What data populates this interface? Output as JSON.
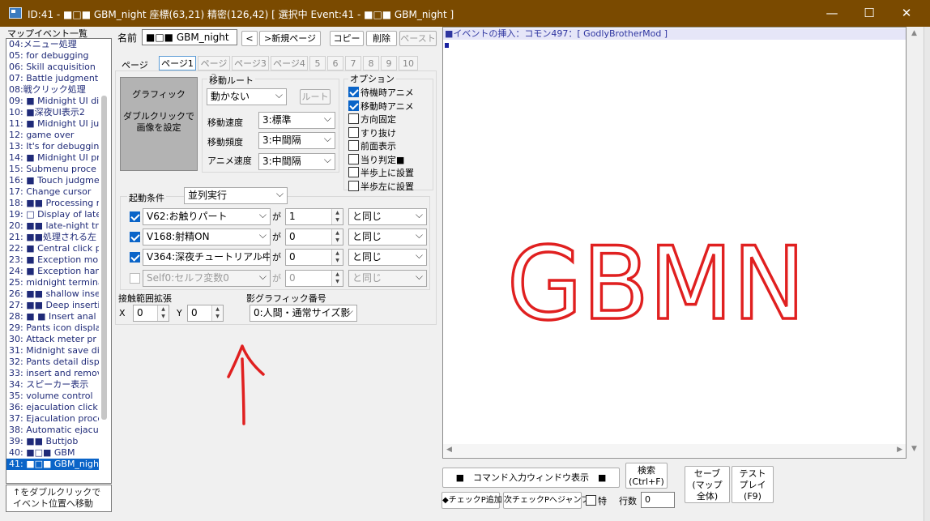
{
  "titlebar": {
    "title": "ID:41 - ■□■ GBM_night 座標(63,21) 精密(126,42) [ 選択中 Event:41 - ■□■ GBM_night ]",
    "minimize": "—",
    "maximize": "☐",
    "close": "✕"
  },
  "event_list": {
    "header": "マップイベント一覧",
    "items": [
      "04:メニュー処理",
      "05: for debugging",
      "06: Skill acquisition r",
      "07: Battle judgment",
      "08:戦クリック処理",
      "09: ■ Midnight UI dis",
      "10: ■深夜UI表示2",
      "11: ■ Midnight UI ju",
      "12: game over",
      "13: It's for debuggin",
      "14: ■ Midnight UI pr",
      "15: Submenu proce",
      "16: ■ Touch judgme",
      "17: Change cursor",
      "18: ■■ Processing ri",
      "19: □ Display of late-",
      "20: ■■ late-night tre",
      "21: ■■処理される左",
      "22: ■ Central click pr",
      "23: ■ Exception mor",
      "24: ■ Exception han",
      "25: midnight termina",
      "26: ■■ shallow inser",
      "27: ■■ Deep insertic",
      "28: ■ ■ Insert anal",
      "29: Pants icon displa",
      "30: Attack meter pr",
      "31: Midnight save di",
      "32: Pants detail disp",
      "33: insert and remov",
      "34: スピーカー表示",
      "35: volume control",
      "36: ejaculation click",
      "37: Ejaculation proce",
      "38: Automatic ejacu",
      "39: ■■ Buttjob",
      "40: ■□■ GBM",
      "41: ■□■ GBM_night"
    ],
    "selected_index": 37,
    "hint": "↑をダブルクリックで\nイベント位置へ移動"
  },
  "name_row": {
    "label": "名前",
    "value": "■□■ GBM_night",
    "prev_button": "<",
    "new_page_button": ">新規ページ",
    "copy_button": "コピー",
    "delete_button": "削除",
    "paste_button": "ペースト"
  },
  "tabs": {
    "label": "ページ",
    "items": [
      "ページ1",
      "ページ2",
      "ページ3",
      "ページ4",
      "5",
      "6",
      "7",
      "8",
      "9",
      "10"
    ],
    "active_index": 0
  },
  "graphic": {
    "title": "グラフィック",
    "hint_line1": "ダブルクリックで",
    "hint_line2": "画像を設定"
  },
  "move_route": {
    "title": "移動ルート",
    "type": "動かない",
    "route_button": "ルート",
    "speed_label": "移動速度",
    "speed_value": "3:標準",
    "freq_label": "移動頻度",
    "freq_value": "3:中間隔",
    "anim_label": "アニメ速度",
    "anim_value": "3:中間隔"
  },
  "options": {
    "title": "オプション",
    "items": [
      {
        "label": "待機時アニメ",
        "checked": true
      },
      {
        "label": "移動時アニメ",
        "checked": true
      },
      {
        "label": "方向固定",
        "checked": false
      },
      {
        "label": "すり抜け",
        "checked": false
      },
      {
        "label": "前面表示",
        "checked": false
      },
      {
        "label": "当り判定■",
        "checked": false
      },
      {
        "label": "半歩上に設置",
        "checked": false
      },
      {
        "label": "半歩左に設置",
        "checked": false
      }
    ]
  },
  "trigger": {
    "label": "起動条件",
    "value": "並列実行",
    "ga": "が",
    "conditions": [
      {
        "enabled": true,
        "variable": "V62:お触りパート",
        "value": "1",
        "op": "と同じ"
      },
      {
        "enabled": true,
        "variable": "V168:射精ON",
        "value": "0",
        "op": "と同じ"
      },
      {
        "enabled": true,
        "variable": "V364:深夜チュートリアル中",
        "value": "0",
        "op": "と同じ"
      },
      {
        "enabled": false,
        "variable": "Self0:セルフ変数0",
        "value": "0",
        "op": "と同じ"
      }
    ]
  },
  "contact_range": {
    "label": "接触範囲拡張",
    "x_label": "X",
    "x_value": "0",
    "y_label": "Y",
    "y_value": "0"
  },
  "shadow": {
    "label": "影グラフィック番号",
    "value": "0:人間・通常サイズ影"
  },
  "annotations": {
    "handwriting": "GBMN",
    "ink_color": "#e02020"
  },
  "command_pane": {
    "line1": "■イベントの挿入：コモン497：[ GodlyBrotherMod ]"
  },
  "bottom": {
    "command_window_button": "■　コマンド入力ウィンドウ表示　■",
    "search_line1": "検索",
    "search_line2": "(Ctrl+F)",
    "save_line1": "セーブ",
    "save_line2": "(マップ",
    "save_line3": "全体)",
    "test_line1": "テスト",
    "test_line2": "プレイ",
    "test_line3": "(F9)",
    "check_add": "◆チェックP追加",
    "next_check": "次チェックPへジャンプ",
    "special_label": "特",
    "row_count_label": "行数",
    "row_count_value": "0"
  },
  "colors": {
    "titlebar": "#7a4a00",
    "selection": "#0a64c8",
    "command_highlight": "#e6e6f8"
  }
}
